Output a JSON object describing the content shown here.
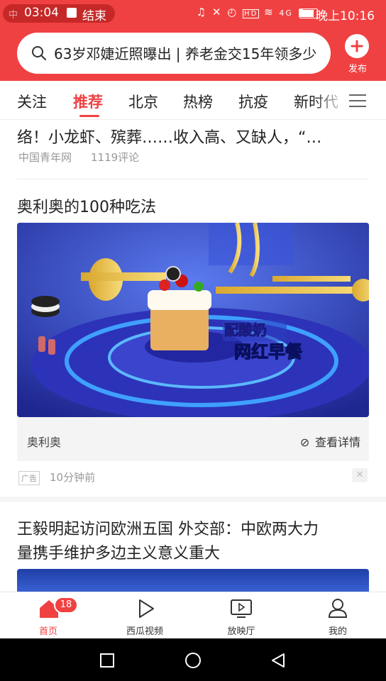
{
  "status_bar": {
    "time": "03:04",
    "call_label": "结束",
    "right_time": "晚上10:16",
    "network": "4G"
  },
  "search": {
    "placeholder": "63岁邓婕近照曝出 | 养老金交15年领多少"
  },
  "header": {
    "publish_label": "发布"
  },
  "tabs": [
    "关注",
    "推荐",
    "北京",
    "热榜",
    "抗疫",
    "新时代"
  ],
  "feed": {
    "article1": {
      "title_tail": "络！小龙虾、殡葬……收入高、又缺人，“…",
      "source": "中国青年网",
      "comments": "1119评论"
    },
    "ad": {
      "title": "奥利奥的100种吃法",
      "image_caption_1": "配酸奶",
      "image_caption_2": "网红早餐",
      "brand": "奥利奥",
      "cta": "查看详情",
      "tag": "广告",
      "time": "10分钟前"
    },
    "article2": {
      "title_line1": "王毅明起访问欧洲五国 外交部：中欧两大力",
      "title_line2": "量携手维护多边主义意义重大"
    }
  },
  "bottom_nav": {
    "items": [
      {
        "label": "首页",
        "icon": "home-icon"
      },
      {
        "label": "西瓜视频",
        "icon": "play-icon"
      },
      {
        "label": "放映厅",
        "icon": "tv-icon"
      },
      {
        "label": "我的",
        "icon": "user-icon"
      }
    ],
    "badge": "18"
  },
  "colors": {
    "accent": "#f04142",
    "ad_bg": "#2a31a8"
  }
}
